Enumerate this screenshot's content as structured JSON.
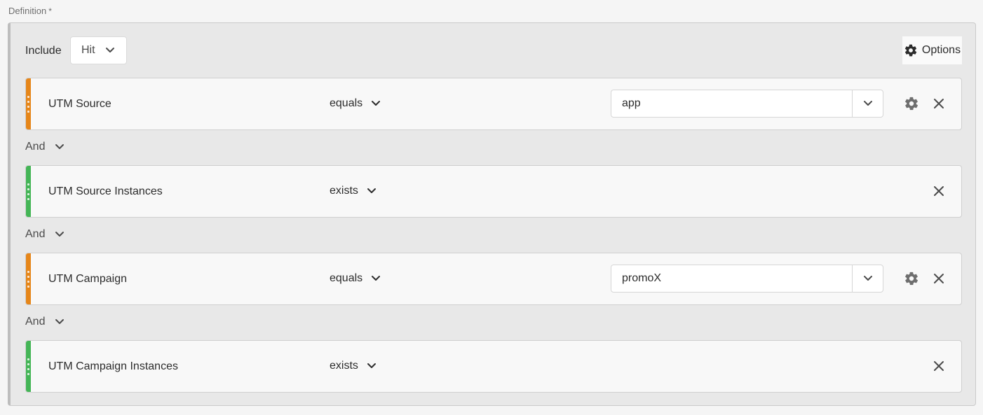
{
  "definition": {
    "label": "Definition",
    "required_mark": "*"
  },
  "header": {
    "include_label": "Include",
    "scope_value": "Hit",
    "options_label": "Options"
  },
  "colors": {
    "dimension": "#e68619",
    "metric": "#44b556"
  },
  "rules": [
    {
      "field": "UTM Source",
      "operator": "equals",
      "value": "app",
      "type": "dimension"
    },
    {
      "field": "UTM Source Instances",
      "operator": "exists",
      "type": "metric"
    },
    {
      "field": "UTM Campaign",
      "operator": "equals",
      "value": "promoX",
      "type": "dimension"
    },
    {
      "field": "UTM Campaign Instances",
      "operator": "exists",
      "type": "metric"
    }
  ],
  "connectors": [
    "And",
    "And",
    "And"
  ]
}
